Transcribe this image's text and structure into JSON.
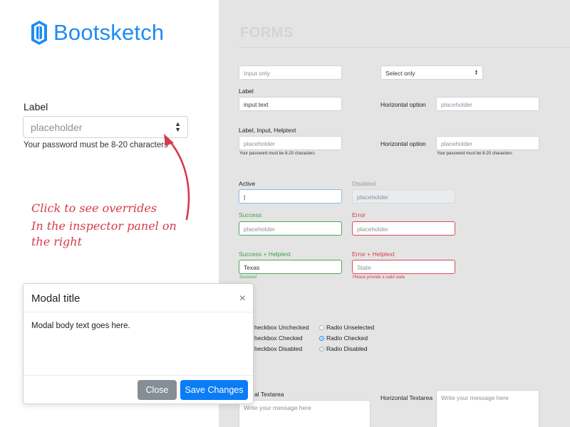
{
  "brand": {
    "name": "Bootsketch",
    "accent": "#1f8bf2"
  },
  "demo": {
    "label": "Label",
    "select_placeholder": "placeholder",
    "help": "Your password must be 8-20 characters",
    "caret_icon": "sort-icon"
  },
  "hint": {
    "lines": [
      "Click to see overrides",
      "In the inspector panel on",
      "the right"
    ],
    "color": "#d33b4b"
  },
  "forms": {
    "title": "FORMS",
    "input_only": "Input only",
    "select_only": "Select only",
    "label": "Label",
    "input_text": "input text",
    "horizontal_option": "Horizontal option",
    "placeholder": "placeholder",
    "label_input_helptext": "Label, Input, Helptext",
    "help_password": "Your password must be 8-20 characters",
    "active": "Active",
    "active_value": "|",
    "disabled": "Disabled",
    "success": "Success",
    "error": "Error",
    "success_helptext": "Success + Helptext",
    "success_value": "Texas",
    "success_help": "Success!",
    "error_helptext": "Error + Helptext",
    "error_placeholder": "State",
    "error_help": "Please provide a valid state",
    "checks": [
      "heckbox Unchecked",
      "heckbox Checked",
      "heckbox Disabled"
    ],
    "radios": [
      "Radio Unselected",
      "Radio Checked",
      "Radio Disabled"
    ],
    "textarea_label": "al Textarea",
    "horizontal_textarea": "Horizontal Textarea",
    "textarea_placeholder": "Write your message here"
  },
  "modal": {
    "title": "Modal title",
    "close_glyph": "×",
    "body": "Modal body text goes here.",
    "close_button": "Close",
    "save_button": "Save Changes"
  }
}
